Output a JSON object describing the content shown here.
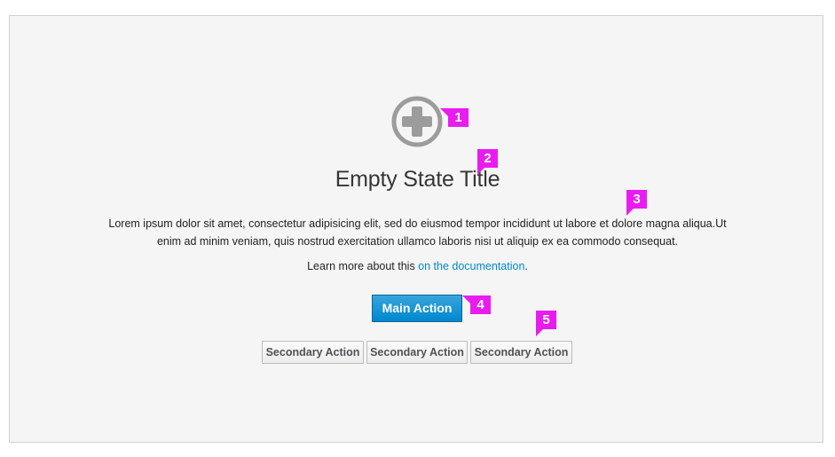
{
  "empty_state": {
    "icon": "add-circle-icon",
    "title": "Empty State Title",
    "description": "Lorem ipsum dolor sit amet, consectetur adipisicing elit, sed do eiusmod tempor incididunt ut labore et dolore magna aliqua.Ut enim ad minim veniam, quis nostrud exercitation ullamco laboris nisi ut aliquip ex ea commodo consequat.",
    "learn_more_prefix": "Learn more about this ",
    "learn_more_link": "on the documentation",
    "learn_more_suffix": ".",
    "main_action_label": "Main Action",
    "secondary_actions": [
      "Secondary Action",
      "Secondary Action",
      "Secondary Action"
    ]
  },
  "annotations": {
    "markers": [
      "1",
      "2",
      "3",
      "4",
      "5"
    ],
    "color": "#e91cf0"
  },
  "colors": {
    "panel_bg": "#f5f5f5",
    "primary": "#0088ce",
    "icon_gray": "#9c9c9c"
  }
}
